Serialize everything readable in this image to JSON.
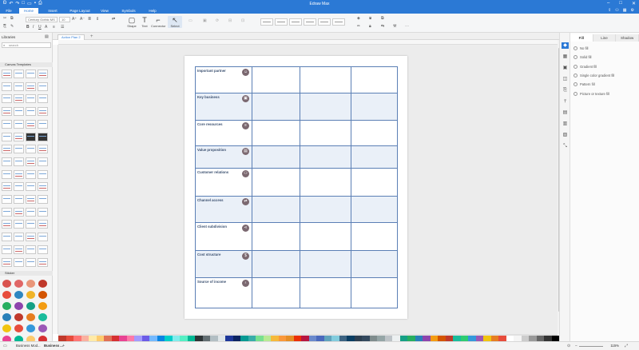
{
  "app": {
    "title": "Edraw Max"
  },
  "menu": {
    "items": [
      "File",
      "Home",
      "Insert",
      "Page Layout",
      "View",
      "Symbols",
      "Help"
    ],
    "active": "Home"
  },
  "ribbon": {
    "font_name": "Century Gothic MS",
    "font_size": "10",
    "tools": [
      {
        "label": "Shape",
        "icon": "shape-icon"
      },
      {
        "label": "Text",
        "icon": "text-icon"
      },
      {
        "label": "Connector",
        "icon": "connector-icon"
      },
      {
        "label": "Select",
        "icon": "select-icon"
      }
    ]
  },
  "left_panel": {
    "libraries_label": "Libraries",
    "search_placeholder": "search",
    "canvas_templates_label": "Canvas Templates",
    "sticker_label": "Sticker"
  },
  "document_tab": {
    "label": "Action Plan 2"
  },
  "canvas": {
    "rows": [
      {
        "label": "Important partner",
        "icon": "person-icon"
      },
      {
        "label": "Key business",
        "icon": "briefcase-icon"
      },
      {
        "label": "Core resources",
        "icon": "database-icon"
      },
      {
        "label": "Value proposition",
        "icon": "document-icon"
      },
      {
        "label": "Customer relations",
        "icon": "group-icon"
      },
      {
        "label": "Channel access",
        "icon": "shuffle-icon"
      },
      {
        "label": "Client subdivision",
        "icon": "share-icon"
      },
      {
        "label": "Cost structure",
        "icon": "dollar-icon"
      },
      {
        "label": "Source of income",
        "icon": "money-bag-icon"
      }
    ]
  },
  "right_panel": {
    "tabs": [
      "Fill",
      "Line",
      "Shadow"
    ],
    "active_tab": "Fill",
    "options": [
      "No fill",
      "Solid fill",
      "Gradient fill",
      "Single color gradient fill",
      "Pattern fill",
      "Picture or texture fill"
    ]
  },
  "status": {
    "pages": [
      "Business Mod...",
      "Business ..."
    ],
    "zoom": "115%"
  },
  "colors": {
    "accent": "#2b79d5",
    "grid_line": "#5b7fb5",
    "alt_row": "#eaf0f8"
  }
}
